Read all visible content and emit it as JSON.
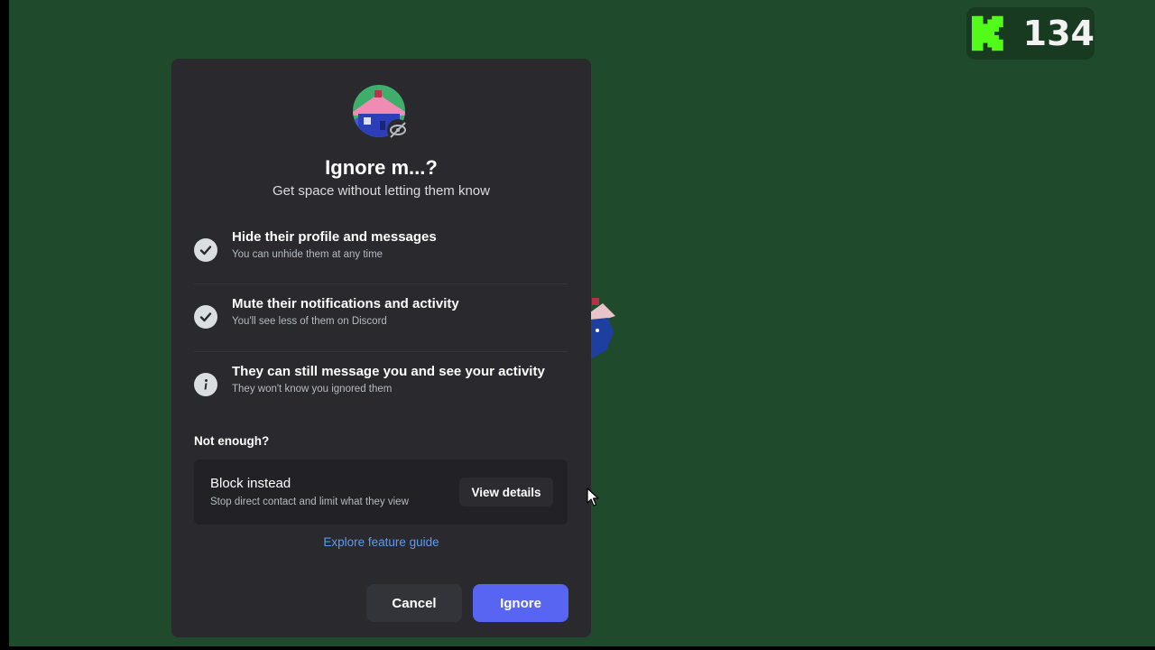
{
  "stream_overlay": {
    "viewer_count": "134",
    "logo_icon": "kick-logo-icon",
    "accent": "#53fc18"
  },
  "modal": {
    "avatar_icon": "house-avatar-with-eye-slash-icon",
    "title": "Ignore m...?",
    "subtitle": "Get space without letting them know",
    "features": [
      {
        "icon": "check-circle-icon",
        "title": "Hide their profile and messages",
        "description": "You can unhide them at any time"
      },
      {
        "icon": "check-circle-icon",
        "title": "Mute their notifications and activity",
        "description": "You'll see less of them on Discord"
      },
      {
        "icon": "info-circle-icon",
        "title": "They can still message you and see your activity",
        "description": "They won't know you ignored them"
      }
    ],
    "not_enough_label": "Not enough?",
    "block_card": {
      "title": "Block instead",
      "description": "Stop direct contact and limit what they view",
      "button_label": "View details"
    },
    "explore_link": "Explore feature guide",
    "cancel_label": "Cancel",
    "ignore_label": "Ignore"
  },
  "colors": {
    "background": "#1f4a2b",
    "modal": "#29292e",
    "primary_button": "#5865f2",
    "link": "#5c9bf0"
  }
}
